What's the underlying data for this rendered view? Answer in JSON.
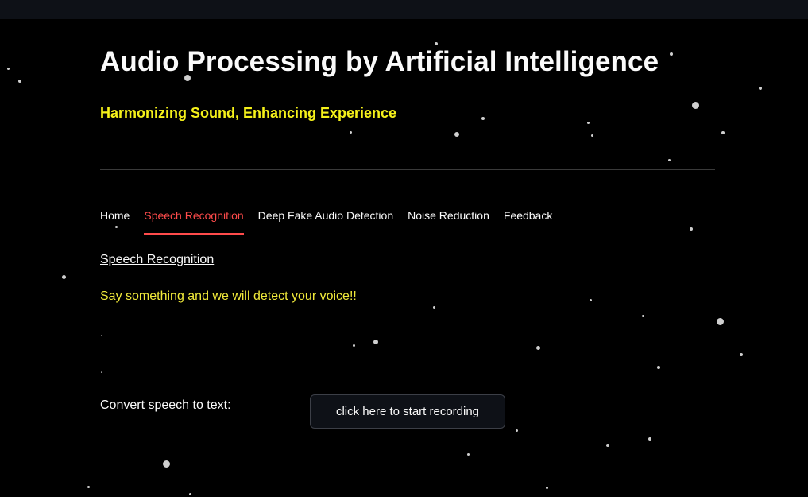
{
  "header": {
    "title": "Audio Processing by Artificial Intelligence",
    "subtitle": "Harmonizing Sound, Enhancing Experience"
  },
  "tabs": [
    {
      "label": "Home",
      "active": false
    },
    {
      "label": "Speech Recognition",
      "active": true
    },
    {
      "label": "Deep Fake Audio Detection",
      "active": false
    },
    {
      "label": "Noise Reduction",
      "active": false
    },
    {
      "label": "Feedback",
      "active": false
    }
  ],
  "main": {
    "section_heading": "Speech Recognition",
    "prompt": "Say something and we will detect your voice!!",
    "dot_line_1": ".",
    "dot_line_2": ".",
    "convert_label": "Convert speech to text:",
    "record_button_label": "click here to start recording"
  },
  "colors": {
    "background": "#000000",
    "topbar": "#0e1117",
    "subtitle": "#f5f11a",
    "prompt": "#f0e93a",
    "active_tab": "#ff4b4b"
  }
}
